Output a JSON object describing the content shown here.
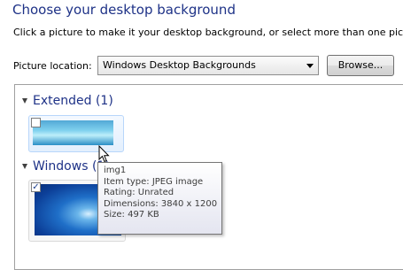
{
  "header": {
    "title": "Choose your desktop background",
    "subtitle": "Click a picture to make it your desktop background, or select more than one picture"
  },
  "location": {
    "label": "Picture location:",
    "selected": "Windows Desktop Backgrounds",
    "browse_label": "Browse..."
  },
  "groups": [
    {
      "label": "Extended (1)",
      "item_checked": false
    },
    {
      "label": "Windows (1)",
      "item_checked": true
    }
  ],
  "tooltip": {
    "name": "img1",
    "type": "Item type: JPEG image",
    "rating": "Rating: Unrated",
    "dimensions": "Dimensions: 3840 x 1200",
    "size": "Size: 497 KB"
  },
  "colors": {
    "title": "#1e3287",
    "selection_border": "#b8d6fb"
  },
  "icons": {
    "collapse": "triangle-down-icon",
    "cursor": "arrow-cursor-icon",
    "checkbox": "checkbox-icon"
  }
}
